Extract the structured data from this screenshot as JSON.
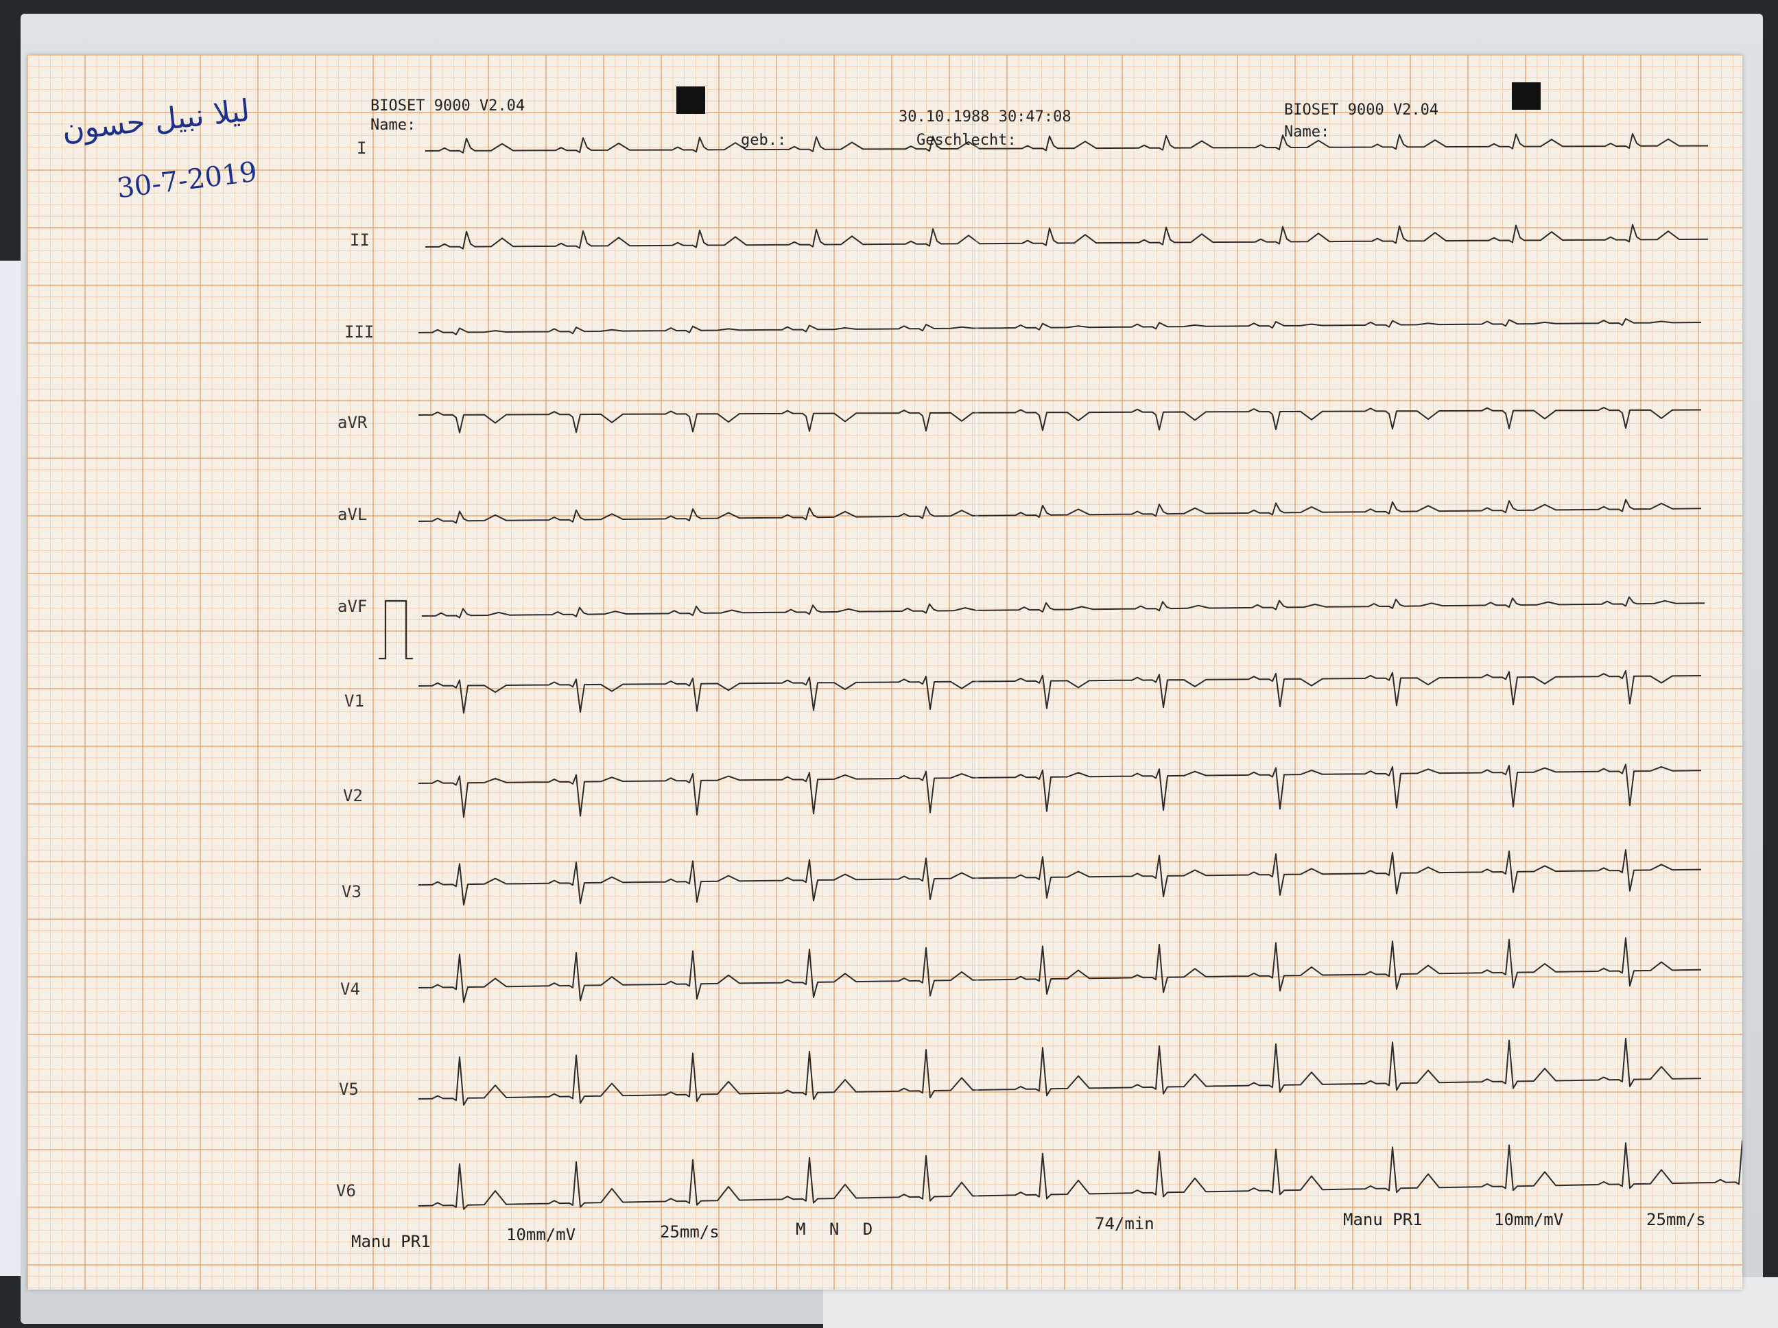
{
  "header_left": {
    "device": "BIOSET 9000 V2.04",
    "name_label": "Name:"
  },
  "header_mid": {
    "datetime": "30.10.1988 30:47:08",
    "dob_label": "geb.:",
    "sex_label": "Geschlecht:"
  },
  "header_right": {
    "device": "BIOSET 9000 V2.04",
    "name_label": "Name:"
  },
  "handwriting": {
    "name": "ليلا نبيل حسون",
    "date": "30-7-2019"
  },
  "leads": [
    "I",
    "II",
    "III",
    "aVR",
    "aVL",
    "aVF",
    "V1",
    "V2",
    "V3",
    "V4",
    "V5",
    "V6"
  ],
  "footer_left": {
    "mode": "Manu PR1",
    "gain": "10mm/mV",
    "speed": "25mm/s",
    "filter": "M N D"
  },
  "heart_rate": "74/min",
  "footer_right": {
    "mode": "Manu PR1",
    "gain": "10mm/mV",
    "speed": "25mm/s"
  },
  "colors": {
    "grid_minor": "#f3ccaa",
    "grid_major": "#e9a56f",
    "paper": "#f6efe6",
    "trace": "#2b2b2b",
    "ink": "#1d2f8a"
  }
}
